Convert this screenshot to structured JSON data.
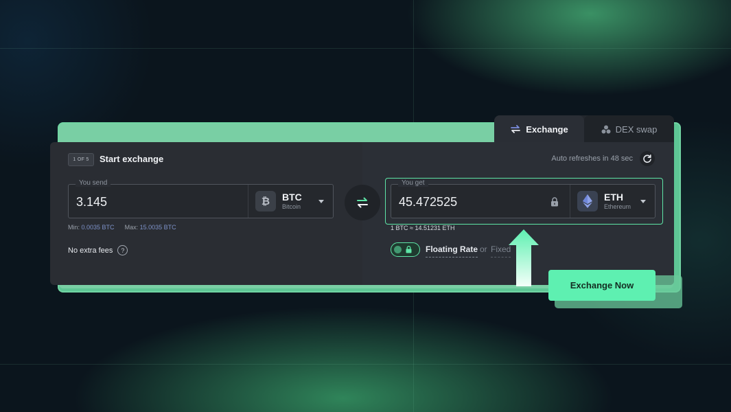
{
  "tabs": {
    "exchange": "Exchange",
    "dex_swap": "DEX swap"
  },
  "step": {
    "badge": "1 OF 5",
    "title": "Start exchange"
  },
  "auto_refresh": "Auto refreshes in 48 sec",
  "send": {
    "legend": "You send",
    "amount": "3.145",
    "coin_symbol": "BTC",
    "coin_name": "Bitcoin",
    "min_label": "Min:",
    "min_value": "0.0035 BTC",
    "max_label": "Max:",
    "max_value": "15.0035 BTC"
  },
  "get": {
    "legend": "You get",
    "amount": "45.472525",
    "coin_symbol": "ETH",
    "coin_name": "Ethereum",
    "rate": "1 BTC ≈ 14.51231 ETH"
  },
  "fees": {
    "label": "No extra fees",
    "help": "?"
  },
  "rate_type": {
    "floating": "Floating Rate",
    "or": "or",
    "fixed": "Fixed"
  },
  "cta": "Exchange Now",
  "colors": {
    "accent": "#5ef0b1",
    "background": "#0b151d",
    "card": "#2a2d33"
  },
  "icons": {
    "exchange_tab": "exchange-arrows-icon",
    "dex_tab": "dex-circles-icon",
    "refresh": "refresh-icon",
    "btc": "bitcoin-icon",
    "eth": "ethereum-icon",
    "swap": "swap-arrows-icon",
    "lock": "lock-icon",
    "arrow": "arrow-up-icon"
  }
}
